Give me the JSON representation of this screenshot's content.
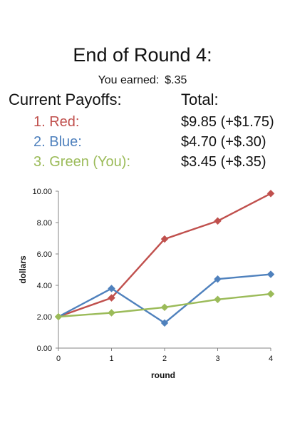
{
  "title": "End of Round 4:",
  "earned": {
    "label": "You earned:",
    "amount": "$.35"
  },
  "payoffs": {
    "header": "Current Payoffs:",
    "total_header": "Total:",
    "rows": [
      {
        "label": "1. Red:",
        "total": "$9.85 (+$1.75)",
        "color": "#c0504d"
      },
      {
        "label": "2. Blue:",
        "total": "$4.70 (+$.30)",
        "color": "#4f81bd"
      },
      {
        "label": "3. Green (You):",
        "total": "$3.45 (+$.35)",
        "color": "#9bbb59"
      }
    ]
  },
  "chart_data": {
    "type": "line",
    "x": [
      0,
      1,
      2,
      3,
      4
    ],
    "xlabel": "round",
    "ylabel": "dollars",
    "ylim": [
      0,
      10
    ],
    "xlim": [
      0,
      4
    ],
    "yticks": [
      "0.00",
      "2.00",
      "4.00",
      "6.00",
      "8.00",
      "10.00"
    ],
    "xticks": [
      "0",
      "1",
      "2",
      "3",
      "4"
    ],
    "grid": false,
    "legend": "none",
    "series": [
      {
        "color": "#c0504d",
        "values": [
          2.0,
          3.2,
          6.95,
          8.1,
          9.85
        ]
      },
      {
        "color": "#4f81bd",
        "values": [
          2.0,
          3.8,
          1.6,
          4.4,
          4.7
        ]
      },
      {
        "color": "#9bbb59",
        "values": [
          2.0,
          2.25,
          2.6,
          3.1,
          3.45
        ]
      }
    ]
  }
}
